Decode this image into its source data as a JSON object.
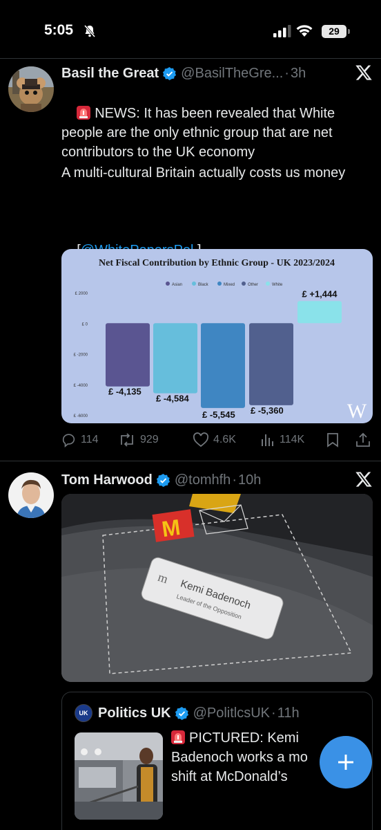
{
  "status_bar": {
    "time": "5:05",
    "battery": "29",
    "icons": [
      "bell-off-icon",
      "signal-icon",
      "wifi-icon",
      "battery-icon"
    ]
  },
  "tweets": [
    {
      "author": "Basil the Great",
      "handle": "@BasilTheGre...",
      "time": "3h",
      "verified": true,
      "text_line1": "NEWS: It has been revealed that White people are the only ethnic group that are net contributors to the UK economy",
      "text_line2": "A multi-cultural Britain actually costs us money",
      "mention_open": "[",
      "mention": "@WhitePapersPol",
      "mention_close": " ]",
      "actions": {
        "replies": "114",
        "reposts": "929",
        "likes": "4.6K",
        "views": "114K"
      }
    },
    {
      "author": "Tom Harwood",
      "handle": "@tomhfh",
      "time": "10h",
      "verified": true,
      "photo_texts": {
        "badge_name": "Kemi Badenoch",
        "badge_title": "Leader of the Opposition"
      },
      "quote": {
        "author": "Politics UK",
        "avatar_text": "UK",
        "handle": "@PolitlcsUK",
        "time": "11h",
        "verified": true,
        "text": "PICTURED: Kemi Badenoch works a mo shift at McDonald’s"
      }
    }
  ],
  "separator": "·",
  "colors": {
    "background": "#000000",
    "accent": "#1d9bf0",
    "muted": "#71767b",
    "chart_bg": "#b7c6ea"
  },
  "chart_data": {
    "type": "bar",
    "title": "Net Fiscal Contribution by Ethnic Group - UK 2023/2024",
    "categories": [
      "Asian",
      "Black",
      "Mixed",
      "Other",
      "White"
    ],
    "values": [
      -4135,
      -4584,
      -5545,
      -5360,
      1444
    ],
    "value_labels": [
      "£ -4,135",
      "£ -4,584",
      "£ -5,545",
      "£ -5,360",
      "£ +1,444"
    ],
    "colors": [
      "#5a5591",
      "#66bedc",
      "#3f86c2",
      "#51608e",
      "#8ae2ea"
    ],
    "legend": [
      "Asian",
      "Black",
      "Mixed",
      "Other",
      "White"
    ],
    "legend_position": "top",
    "y_ticks": [
      "£ 2000",
      "£ 0",
      "£ -2000",
      "£ -4000",
      "£ -6000"
    ],
    "y_tick_values": [
      2000,
      0,
      -2000,
      -4000,
      -6000
    ],
    "ylim": [
      -6000,
      2000
    ],
    "grid": false,
    "watermark": "W"
  }
}
